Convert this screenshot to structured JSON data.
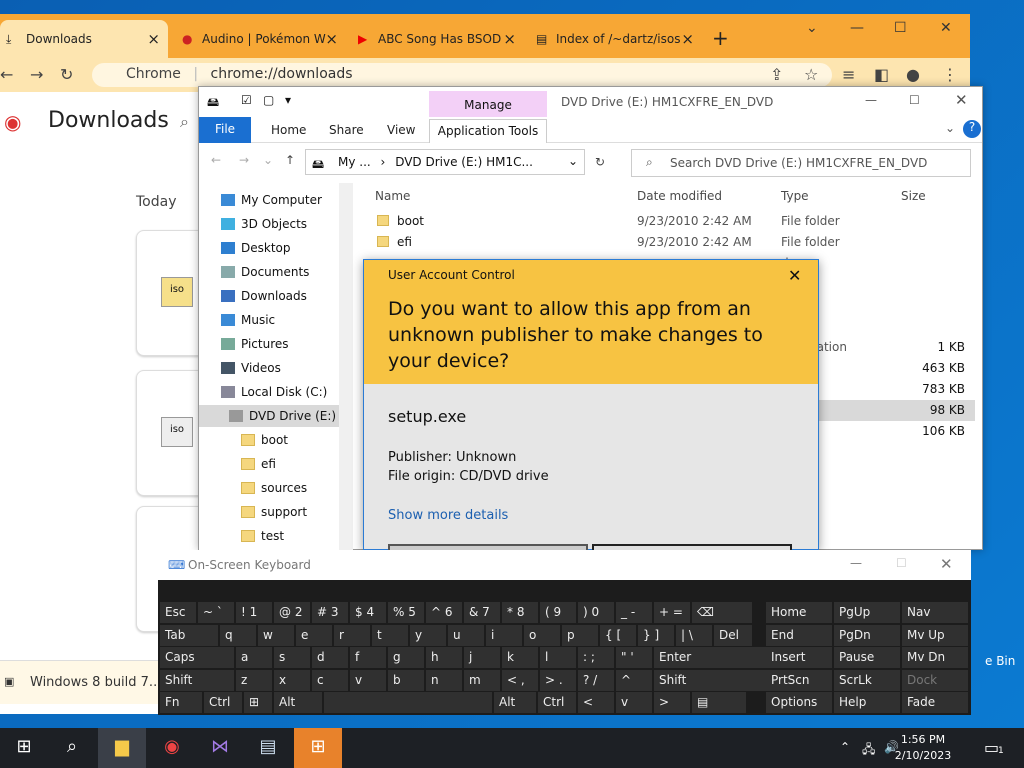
{
  "browser": {
    "tabs": [
      {
        "label": "Downloads",
        "icon": "download-icon"
      },
      {
        "label": "Audino | Pokémon W",
        "icon": "pokemon-icon"
      },
      {
        "label": "ABC Song Has BSOD",
        "icon": "youtube-icon"
      },
      {
        "label": "Index of /~dartz/isos",
        "icon": "folder-icon"
      }
    ],
    "omnibox_chip": "Chrome",
    "omnibox_url": "chrome://downloads",
    "page_title": "Downloads",
    "today_label": "Today",
    "download_bar_item": "Windows 8 build 7....iso"
  },
  "explorer": {
    "window_title": "DVD Drive (E:) HM1CXFRE_EN_DVD",
    "contextual_tab": "Manage",
    "ribbon_tabs": [
      "File",
      "Home",
      "Share",
      "View",
      "Application Tools"
    ],
    "breadcrumb": [
      "My ...",
      "DVD Drive (E:) HM1C..."
    ],
    "search_placeholder": "Search DVD Drive (E:) HM1CXFRE_EN_DVD",
    "tree": [
      "My Computer",
      "3D Objects",
      "Desktop",
      "Documents",
      "Downloads",
      "Music",
      "Pictures",
      "Videos",
      "Local Disk (C:)",
      "DVD Drive (E:) H",
      "boot",
      "efi",
      "sources",
      "support",
      "test"
    ],
    "columns": [
      "Name",
      "Date modified",
      "Type",
      "Size"
    ],
    "files": [
      {
        "name": "boot",
        "date": "9/23/2010 2:42 AM",
        "type": "File folder",
        "size": ""
      },
      {
        "name": "efi",
        "date": "9/23/2010 2:42 AM",
        "type": "File folder",
        "size": ""
      },
      {
        "name": "",
        "date": "",
        "type": "der",
        "size": ""
      },
      {
        "name": "",
        "date": "",
        "type": "der",
        "size": ""
      },
      {
        "name": "",
        "date": "",
        "type": "der",
        "size": ""
      },
      {
        "name": "",
        "date": "",
        "type": "der",
        "size": ""
      },
      {
        "name": "",
        "date": "",
        "type": "nformation",
        "size": "1 KB"
      },
      {
        "name": "",
        "date": "",
        "type": "",
        "size": "463 KB"
      },
      {
        "name": "",
        "date": "",
        "type": "",
        "size": "783 KB"
      },
      {
        "name": "",
        "date": "",
        "type": "ation",
        "size": "98 KB"
      },
      {
        "name": "",
        "date": "",
        "type": "ation",
        "size": "106 KB"
      }
    ]
  },
  "uac": {
    "title": "User Account Control",
    "question": "Do you want to allow this app from an unknown publisher to make changes to your device?",
    "app": "setup.exe",
    "publisher": "Publisher: Unknown",
    "origin": "File origin: CD/DVD drive",
    "more": "Show more details"
  },
  "osk": {
    "title": "On-Screen Keyboard",
    "rows": [
      [
        "Esc",
        "~ `",
        "! 1",
        "@ 2",
        "# 3",
        "$ 4",
        "% 5",
        "^ 6",
        "& 7",
        "* 8",
        "( 9",
        ") 0",
        "_ -",
        "+ =",
        "⌫"
      ],
      [
        "Tab",
        "q",
        "w",
        "e",
        "r",
        "t",
        "y",
        "u",
        "i",
        "o",
        "p",
        "{ [",
        "} ]",
        "| \\",
        "Del"
      ],
      [
        "Caps",
        "a",
        "s",
        "d",
        "f",
        "g",
        "h",
        "j",
        "k",
        "l",
        ": ;",
        "\" '",
        "Enter"
      ],
      [
        "Shift",
        "z",
        "x",
        "c",
        "v",
        "b",
        "n",
        "m",
        "< ,",
        "> .",
        "? /",
        "^",
        "Shift"
      ],
      [
        "Fn",
        "Ctrl",
        "⊞",
        "Alt",
        "",
        "Alt",
        "Ctrl",
        "<",
        "v",
        ">",
        "▤"
      ]
    ],
    "nav": [
      [
        "Home",
        "PgUp",
        "Nav"
      ],
      [
        "End",
        "PgDn",
        "Mv Up"
      ],
      [
        "Insert",
        "Pause",
        "Mv Dn"
      ],
      [
        "PrtScn",
        "ScrLk",
        "Dock"
      ],
      [
        "Options",
        "Help",
        "Fade"
      ]
    ]
  },
  "taskbar": {
    "time": "1:56 PM",
    "date": "2/10/2023",
    "notif_count": "1"
  },
  "desktop": {
    "recycle": "e Bin"
  }
}
